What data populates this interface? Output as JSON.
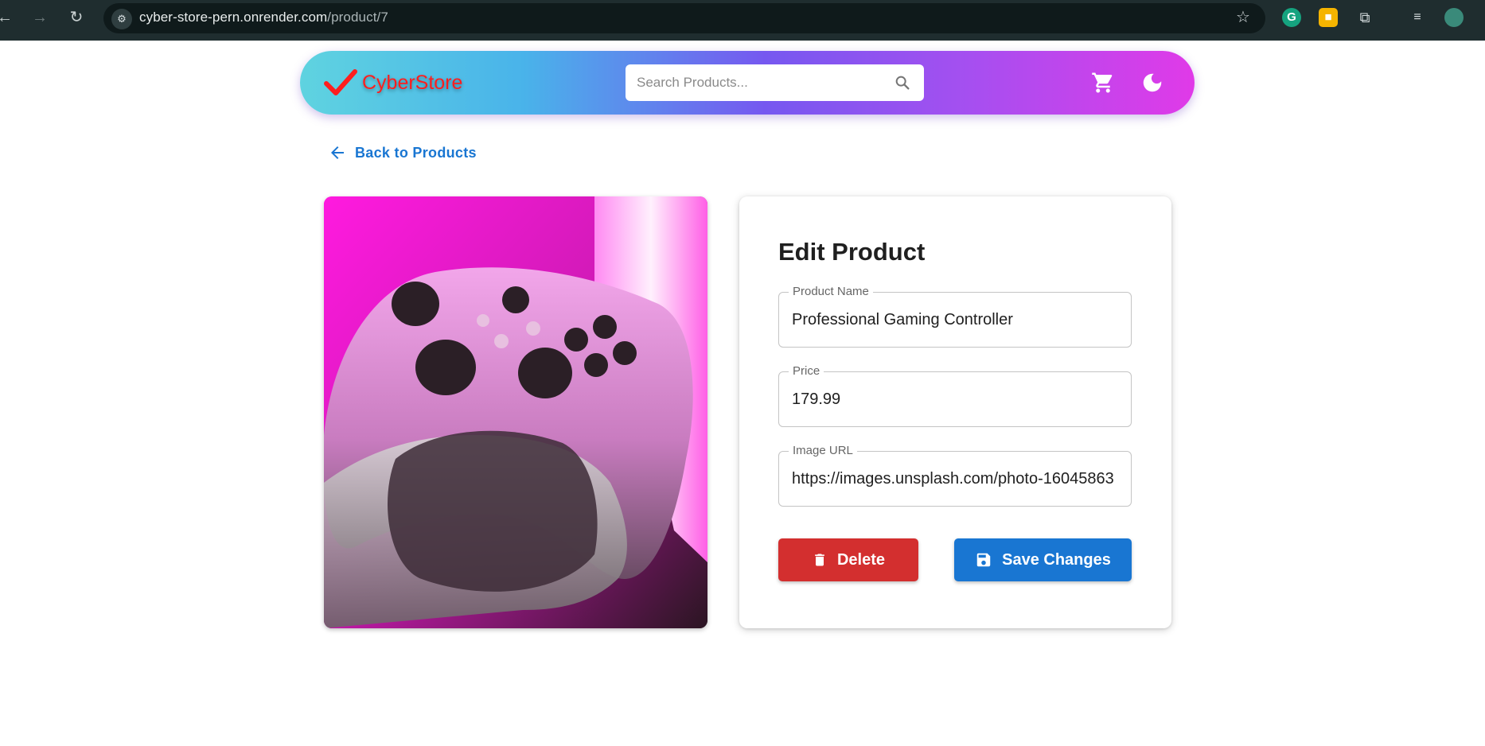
{
  "browser": {
    "url_host": "cyber-store-pern.onrender.com",
    "url_path": "/product/7"
  },
  "header": {
    "logo_text": "CyberStore",
    "search_placeholder": "Search Products..."
  },
  "back_link": {
    "label": "Back to Products"
  },
  "product_image": {
    "subject": "white game controller on pink neon background"
  },
  "edit_card": {
    "title": "Edit Product",
    "fields": [
      {
        "label": "Product Name",
        "value": "Professional Gaming Controller"
      },
      {
        "label": "Price",
        "value": "179.99"
      },
      {
        "label": "Image URL",
        "value": "https://images.unsplash.com/photo-16045863"
      }
    ],
    "delete_label": "Delete",
    "save_label": "Save Changes"
  },
  "colors": {
    "primary": "#1976d2",
    "danger": "#d32f2f",
    "logo": "#ff1e1e"
  }
}
